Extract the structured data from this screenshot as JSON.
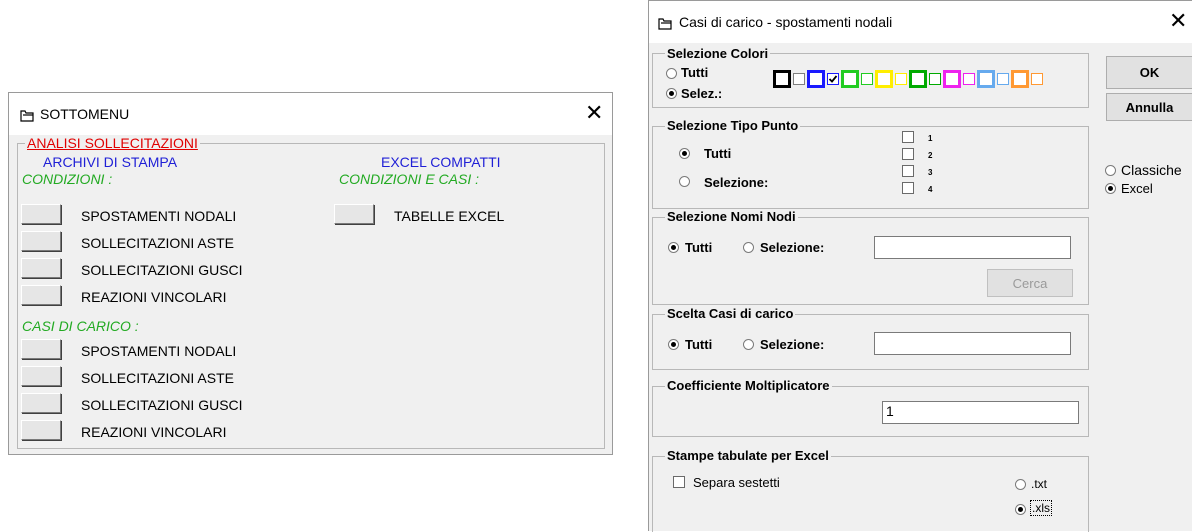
{
  "sottomenu": {
    "title": "SOTTOMENU",
    "group_title": "ANALISI SOLLECITAZIONI",
    "col1_header": "ARCHIVI DI STAMPA",
    "col2_header": "EXCEL COMPATTI",
    "cond_label": "CONDIZIONI :",
    "cond_items": [
      "SPOSTAMENTI NODALI",
      "SOLLECITAZIONI ASTE",
      "SOLLECITAZIONI GUSCI",
      "REAZIONI VINCOLARI"
    ],
    "casi_label": "CASI DI CARICO :",
    "casi_items": [
      "SPOSTAMENTI NODALI",
      "SOLLECITAZIONI ASTE",
      "SOLLECITAZIONI GUSCI",
      "REAZIONI VINCOLARI"
    ],
    "cond_casi_label": "CONDIZIONI E CASI :",
    "excel_item": "TABELLE EXCEL"
  },
  "casi": {
    "title": "Casi di carico - spostamenti nodali",
    "ok_label": "OK",
    "annulla_label": "Annulla",
    "format_options": [
      "Classiche",
      "Excel"
    ],
    "format_selected": "Excel",
    "colori": {
      "title": "Selezione Colori",
      "opt_tutti": "Tutti",
      "opt_selez": "Selez.:",
      "selected": "Selez.:",
      "swatches": [
        {
          "color": "#000000",
          "checked": false
        },
        {
          "color": "#1a1aff",
          "checked": true
        },
        {
          "color": "#22cc22",
          "checked": false
        },
        {
          "color": "#ffee00",
          "checked": false
        },
        {
          "color": "#00aa00",
          "checked": false
        },
        {
          "color": "#ee22ee",
          "checked": false
        },
        {
          "color": "#66aaee",
          "checked": false
        },
        {
          "color": "#ff9933",
          "checked": false
        }
      ]
    },
    "tipo": {
      "title": "Selezione Tipo Punto",
      "opt_tutti": "Tutti",
      "opt_sel": "Selezione:",
      "selected": "Tutti",
      "types": [
        "1",
        "2",
        "3",
        "4"
      ]
    },
    "nomi": {
      "title": "Selezione Nomi Nodi",
      "opt_tutti": "Tutti",
      "opt_sel": "Selezione:",
      "selected": "Tutti",
      "field_value": "",
      "cerca_label": "Cerca"
    },
    "scelta": {
      "title": "Scelta Casi di carico",
      "opt_tutti": "Tutti",
      "opt_sel": "Selezione:",
      "selected": "Tutti",
      "field_value": ""
    },
    "coeff": {
      "title": "Coefficiente Moltiplicatore",
      "value": "1"
    },
    "stampe": {
      "title": "Stampe tabulate per Excel",
      "separa_label": "Separa sestetti",
      "separa_checked": false,
      "opt_txt": ".txt",
      "opt_xls": ".xls",
      "selected": ".xls"
    }
  }
}
